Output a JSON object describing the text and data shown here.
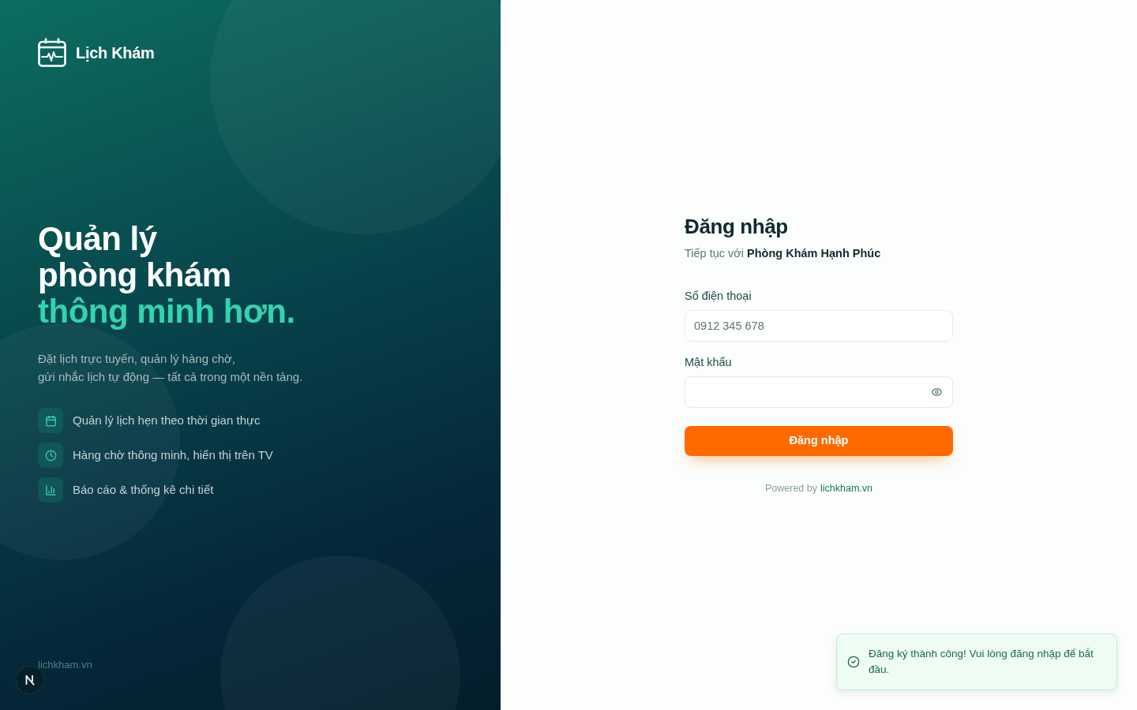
{
  "brand": {
    "name": "Lịch Khám"
  },
  "hero": {
    "headline_lines": [
      "Quản lý",
      "phòng khám"
    ],
    "headline_accent": "thông minh hơn.",
    "description_lines": [
      "Đặt lịch trực tuyến, quản lý hàng chờ,",
      "gửi nhắc lịch tự động — tất cả trong một nền tảng."
    ],
    "features": [
      {
        "text": "Quản lý lịch hẹn theo thời gian thực"
      },
      {
        "text": "Hàng chờ thông minh, hiển thị trên TV"
      },
      {
        "text": "Báo cáo & thống kê chi tiết"
      }
    ]
  },
  "footer_link": "lichkham.vn",
  "login": {
    "title": "Đăng nhập",
    "subtitle": "Tiếp tục với **Phòng Khám Hạnh Phúc**",
    "fields": [
      {
        "kind": "phone",
        "label": "Số điện thoại",
        "placeholder": "0912 345 678"
      },
      {
        "kind": "password",
        "label": "Mật khẩu"
      }
    ],
    "submit": "Đăng nhập",
    "powered_by": {
      "text": "Powered by",
      "link": "lichkham.vn"
    }
  },
  "toast": {
    "message": "Đăng ký thành công! Vui lòng đăng nhập để bắt đầu."
  }
}
